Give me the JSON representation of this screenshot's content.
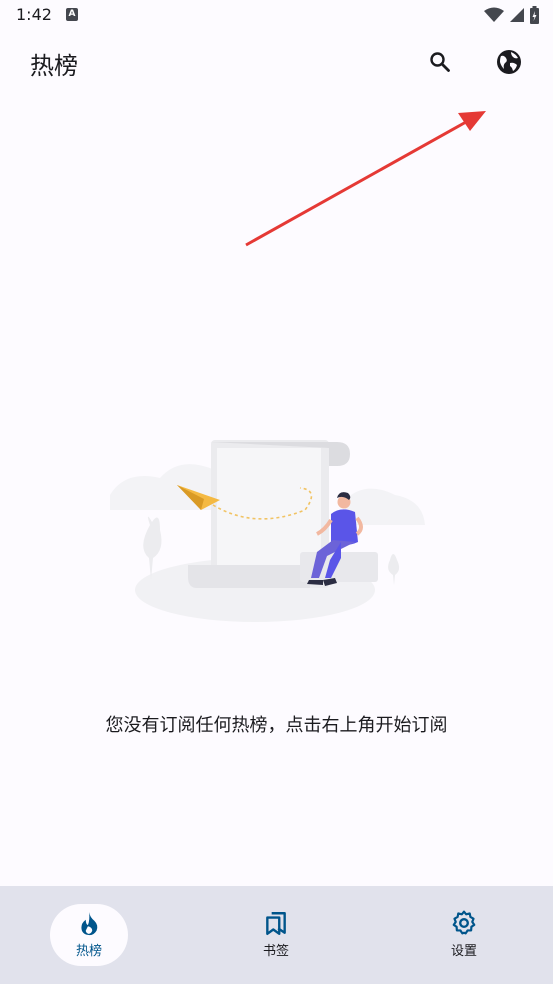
{
  "status_bar": {
    "time": "1:42",
    "notification_icon": "A",
    "icons": [
      "wifi-icon",
      "signal-icon",
      "battery-icon"
    ]
  },
  "app_bar": {
    "title": "热榜",
    "actions": [
      "search-icon",
      "globe-icon"
    ]
  },
  "empty_state": {
    "message": "您没有订阅任何热榜，点击右上角开始订阅"
  },
  "bottom_nav": {
    "items": [
      {
        "label": "热榜",
        "icon": "flame-icon",
        "active": true
      },
      {
        "label": "书签",
        "icon": "bookmarks-icon",
        "active": false
      },
      {
        "label": "设置",
        "icon": "gear-icon",
        "active": false
      }
    ]
  },
  "colors": {
    "background": "#fdfbff",
    "nav_background": "#e1e2ec",
    "accent": "#00558b",
    "annotation_arrow": "#e53935"
  }
}
